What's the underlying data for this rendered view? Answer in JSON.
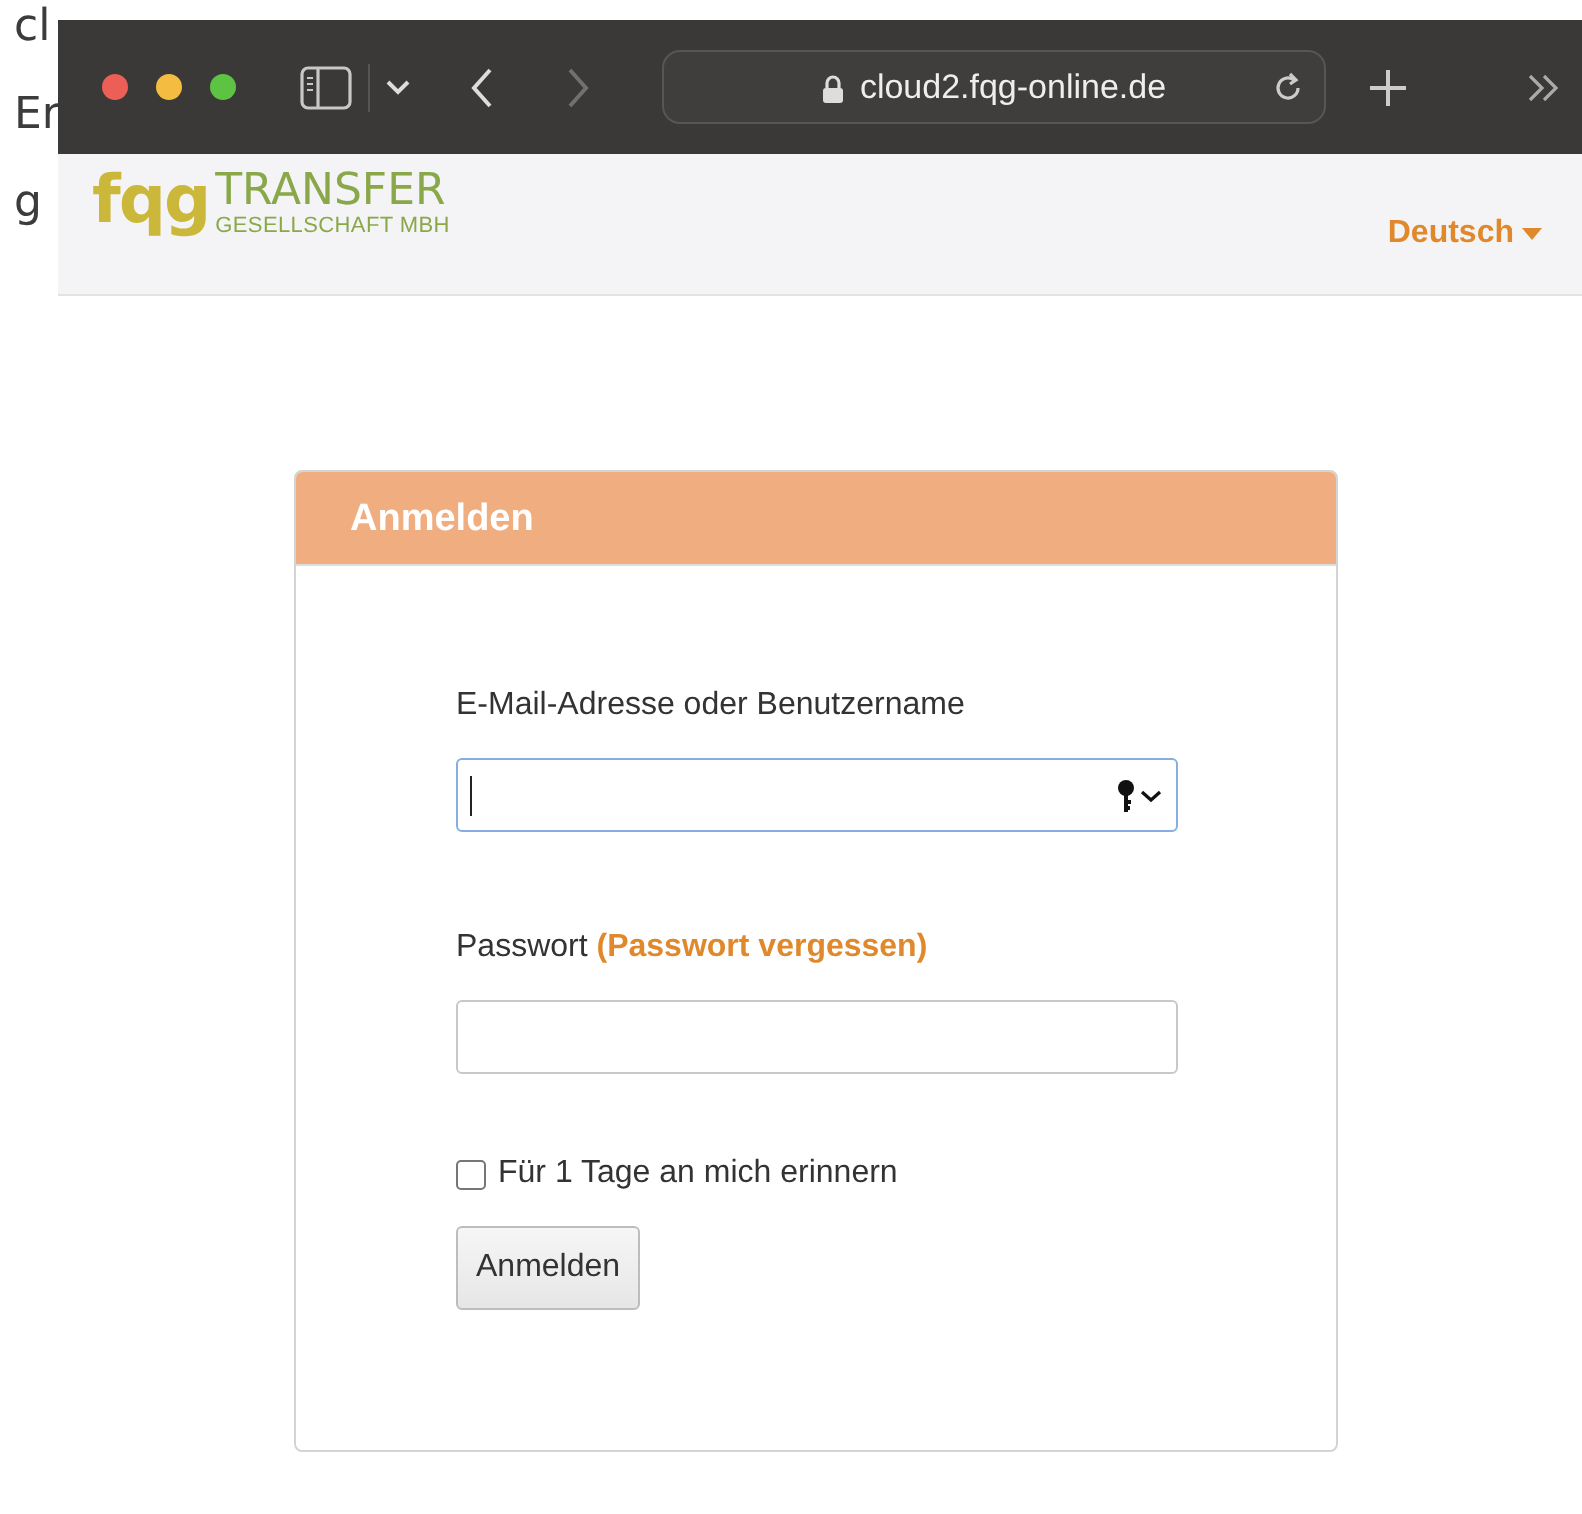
{
  "background_document": {
    "lines": [
      "cl",
      "Er",
      "g"
    ]
  },
  "browser": {
    "address": "cloud2.fqg-online.de",
    "secure": true
  },
  "navbar": {
    "logo": {
      "mark": "fqg",
      "name": "TRANSFER",
      "subtitle": "GESELLSCHAFT MBH"
    },
    "language": "Deutsch"
  },
  "login": {
    "title": "Anmelden",
    "fields": [
      {
        "label": "E-Mail-Adresse oder Benutzername",
        "kind": "text",
        "focused": true
      },
      {
        "label": "Passwort",
        "link": "(Passwort vergessen)",
        "kind": "password",
        "focused": false
      }
    ],
    "remember": {
      "label": "Für 1 Tage an mich erinnern",
      "checked": false
    },
    "submit": "Anmelden"
  }
}
